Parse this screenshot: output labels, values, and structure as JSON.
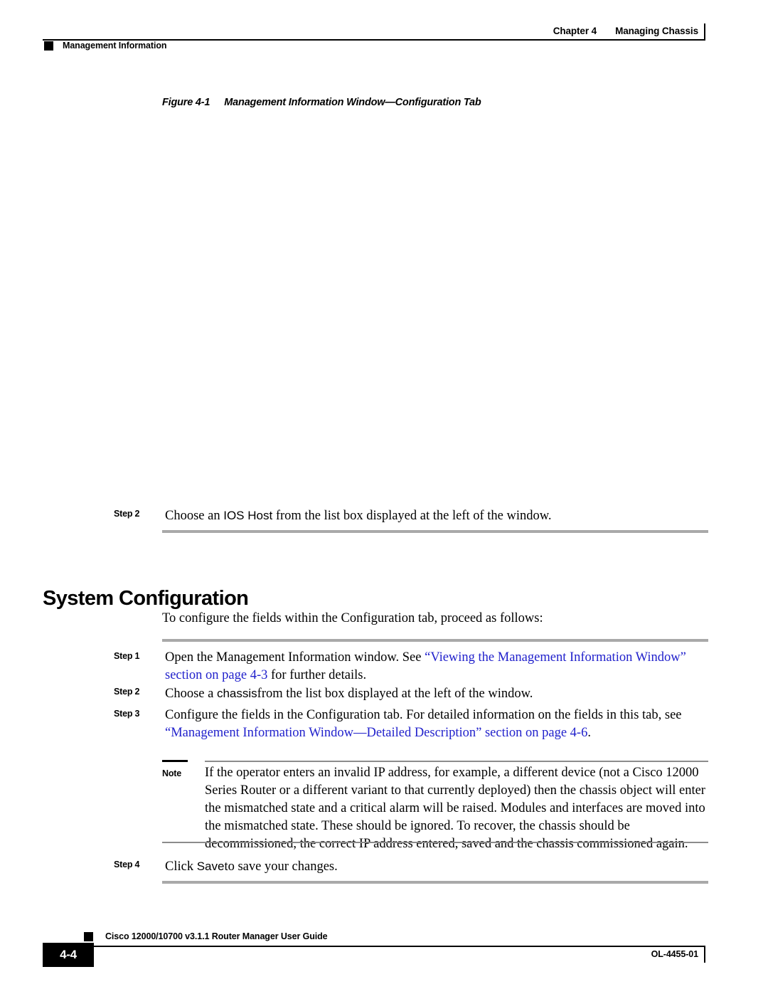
{
  "header": {
    "chapter_number": "Chapter 4",
    "chapter_title": "Managing Chassis",
    "section_title": "Management Information"
  },
  "figure": {
    "number": "Figure 4-1",
    "title": "Management Information Window—Configuration Tab",
    "image_alt": ""
  },
  "steps_top": [
    {
      "label": "Step 2",
      "text": "Choose an ",
      "ui_term": "IOS Host",
      "text_after": " from the list box displayed at the left of the window."
    }
  ],
  "section": {
    "heading": "System Configuration",
    "intro": "To configure the fields within the Configuration tab, proceed as follows:"
  },
  "steps": [
    {
      "label": "Step 1",
      "part1": "Open the Management Information window. See ",
      "link1": "“Viewing the Management Information Window” section on page 4-3",
      "part2": " for further details."
    },
    {
      "label": "Step 2",
      "part1": "Choose a ",
      "ui_term": "chassis",
      "part2": "from the list box displayed at the left of the window."
    },
    {
      "label": "Step 3",
      "part1": "Configure the fields in the Configuration tab. For detailed information on the fields in this tab, see ",
      "link1": "“Management Information Window—Detailed Description” section on page 4-6",
      "part2": "."
    },
    {
      "label": "Step 4",
      "part1": "Click ",
      "ui_term": "Save",
      "part2": "to save your changes."
    }
  ],
  "note": {
    "label": "Note",
    "text": "If the operator enters an invalid IP address, for example, a different device (not a Cisco 12000 Series Router or a different variant to that currently deployed) then the chassis object will enter the mismatched state and a critical alarm will be raised. Modules and interfaces are moved into the mismatched state. These should be ignored. To recover, the chassis should be decommissioned, the correct IP address entered, saved and the chassis commissioned again."
  },
  "footer": {
    "guide_title": "Cisco 12000/10700 v3.1.1 Router Manager User Guide",
    "page_number": "4-4",
    "doc_id": "OL-4455-01"
  },
  "colors": {
    "link": "#2222cc",
    "rule_gray": "#a9a9a9",
    "rule_thin": "#8c8c8c",
    "black": "#000000"
  }
}
